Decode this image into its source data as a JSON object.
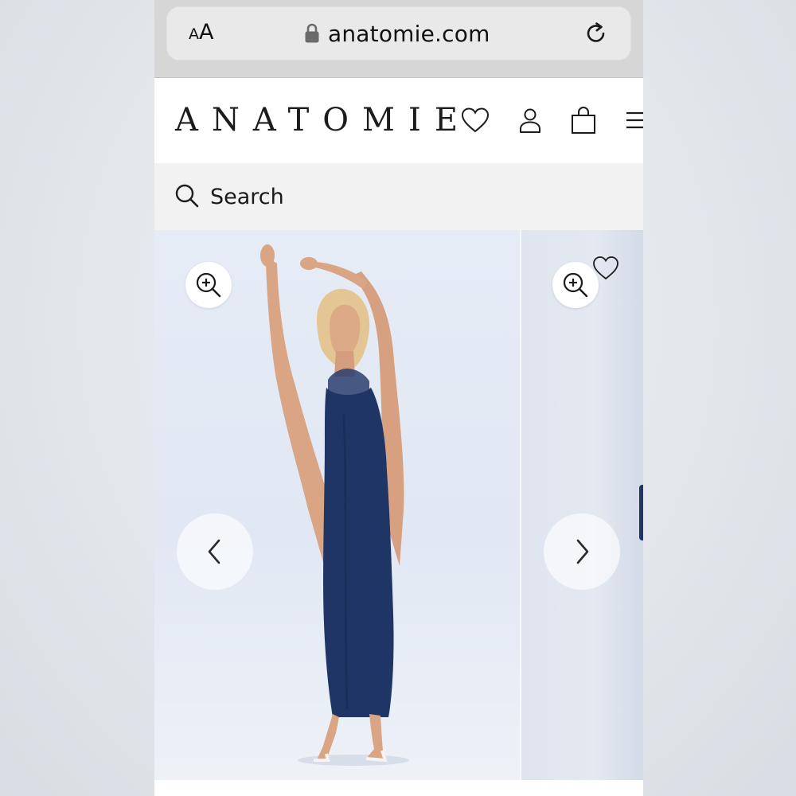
{
  "browser": {
    "text_size_small": "A",
    "text_size_large": "A",
    "url": "anatomie.com"
  },
  "site": {
    "logo": "ANATOMIE"
  },
  "search": {
    "label": "Search"
  },
  "colors": {
    "dress": "#1f3566",
    "accent_text": "#1c1c1c",
    "search_bg": "#f2f2f2",
    "photo_bg": "#e3e9f3"
  },
  "icons": {
    "browser": [
      "text-size-icon",
      "lock-icon",
      "reload-icon"
    ],
    "header": [
      "heart-icon",
      "account-icon",
      "shopping-bag-icon",
      "menu-icon"
    ],
    "gallery": [
      "zoom-in-icon",
      "chevron-left-icon",
      "chevron-right-icon",
      "heart-outline-icon"
    ]
  }
}
